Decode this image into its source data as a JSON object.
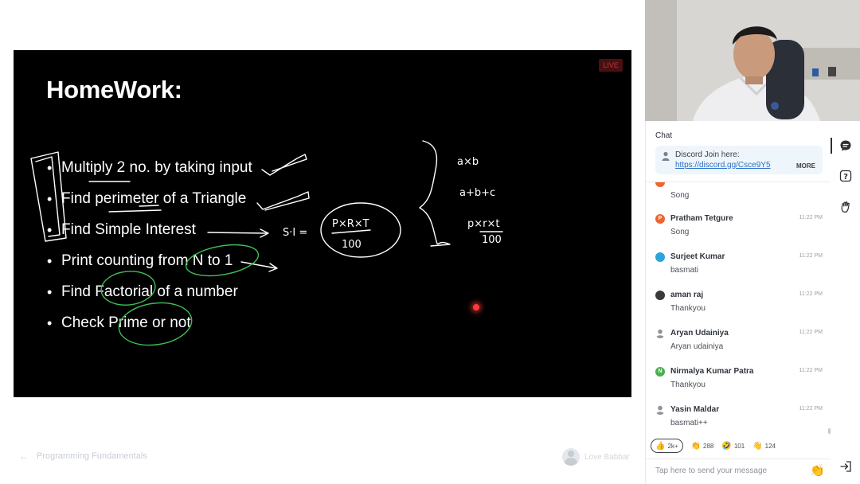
{
  "slide": {
    "live_label": "LIVE",
    "title": "HomeWork:",
    "items": [
      "Multiply 2 no. by taking input",
      "Find perimeter of a Triangle",
      "Find Simple Interest",
      "Print counting from N to 1",
      "Find Factorial of a number",
      "Check Prime or not"
    ],
    "annotations": {
      "si_lhs": "S·I =",
      "si_num": "P×R×T",
      "si_den": "100",
      "note_1": "a×b",
      "note_2": "a+b+c",
      "note_3_num": "p×r×t",
      "note_3_den": "100"
    }
  },
  "footer": {
    "course": "Programming Fundamentals",
    "educator": "Love Babbar"
  },
  "chat": {
    "title": "Chat",
    "pinned": {
      "title": "Discord Join here:",
      "link": "https://discord.gg/Csce9Y5",
      "more": "MORE"
    },
    "messages": [
      {
        "name": "",
        "time": "",
        "text": "Song",
        "avatar_color": "#f0642e",
        "initial": ""
      },
      {
        "name": "Pratham Tetgure",
        "time": "11:22 PM",
        "text": "Song",
        "avatar_color": "#f0642e",
        "initial": "P"
      },
      {
        "name": "Surjeet Kumar",
        "time": "11:22 PM",
        "text": "basmati",
        "avatar_color": "#2aa4d9",
        "initial": ""
      },
      {
        "name": "aman raj",
        "time": "11:22 PM",
        "text": "Thankyou",
        "avatar_color": "#3a3a3a",
        "initial": ""
      },
      {
        "name": "Aryan Udainiya",
        "time": "11:22 PM",
        "text": "Aryan udainiya",
        "avatar_color": "#9aa0a8",
        "initial": ""
      },
      {
        "name": "Nirmalya Kumar Patra",
        "time": "11:22 PM",
        "text": "Thankyou",
        "avatar_color": "#4caf50",
        "initial": "N"
      },
      {
        "name": "Yasin Maldar",
        "time": "11:22 PM",
        "text": "basmati++",
        "avatar_color": "#9aa0a8",
        "initial": ""
      }
    ],
    "reactions": [
      {
        "icon": "thumbs-up-icon",
        "emoji": "👍",
        "count": "2k+"
      },
      {
        "icon": "clap-icon",
        "emoji": "👏",
        "count": "288"
      },
      {
        "icon": "laugh-icon",
        "emoji": "🤣",
        "count": "101"
      },
      {
        "icon": "wave-icon",
        "emoji": "👋",
        "count": "124"
      }
    ],
    "composer": {
      "placeholder": "Tap here to send your message"
    }
  },
  "colors": {
    "slide_bg": "#000000",
    "ink_white": "#ffffff",
    "ink_green": "#3fbf57",
    "link": "#2a71c6",
    "live_red": "#b8393b"
  }
}
